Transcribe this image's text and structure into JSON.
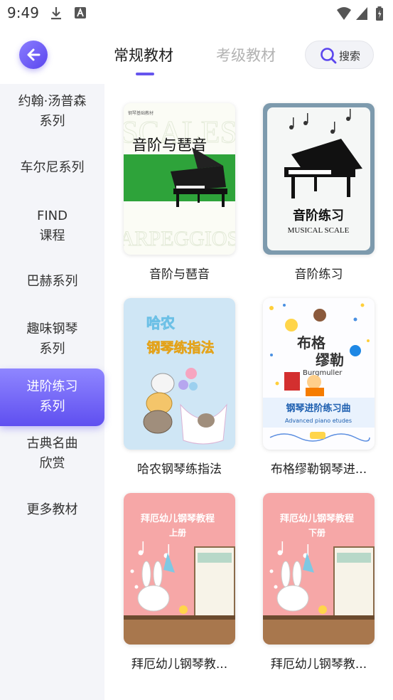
{
  "status": {
    "time": "9:49"
  },
  "header": {
    "tabs": [
      {
        "label": "常规教材",
        "active": true
      },
      {
        "label": "考级教材",
        "active": false
      }
    ],
    "search_label": "搜索"
  },
  "sidebar": {
    "items": [
      {
        "lines": [
          "约翰·汤普森",
          "系列"
        ]
      },
      {
        "lines": [
          "车尔尼系列"
        ]
      },
      {
        "lines": [
          "FIND",
          "课程"
        ]
      },
      {
        "lines": [
          "巴赫系列"
        ]
      },
      {
        "lines": [
          "趣味钢琴",
          "系列"
        ]
      },
      {
        "lines": [
          "进阶练习",
          "系列"
        ],
        "active": true
      },
      {
        "lines": [
          "古典名曲",
          "欣赏"
        ]
      },
      {
        "lines": [
          "更多教材"
        ]
      }
    ]
  },
  "books": [
    {
      "title": "音阶与琶音",
      "cover": {
        "top_label": "钢琴基础教材",
        "bg_words": [
          "SCALES",
          "ARPEGGIOS"
        ],
        "heading": "音阶与琶音"
      }
    },
    {
      "title": "音阶练习",
      "cover": {
        "heading": "音阶练习",
        "sub": "MUSICAL SCALE"
      }
    },
    {
      "title": "哈农钢琴练指法",
      "cover": {
        "line1": "哈农",
        "line2": "钢琴练指法"
      }
    },
    {
      "title": "布格缪勒钢琴进...",
      "cover": {
        "line1": "布格",
        "line2": "缪勒",
        "latin": "Burgmuller",
        "banner": "钢琴进阶练习曲",
        "banner_sub": "Advanced piano etudes"
      }
    },
    {
      "title": "拜厄幼儿钢琴教...",
      "cover": {
        "line1": "拜厄幼儿钢琴教程",
        "line2": "上册"
      }
    },
    {
      "title": "拜厄幼儿钢琴教...",
      "cover": {
        "line1": "拜厄幼儿钢琴教程",
        "line2": "下册"
      }
    }
  ],
  "colors": {
    "accent": "#6655ee",
    "sidebar_bg": "#f4f5f9"
  }
}
